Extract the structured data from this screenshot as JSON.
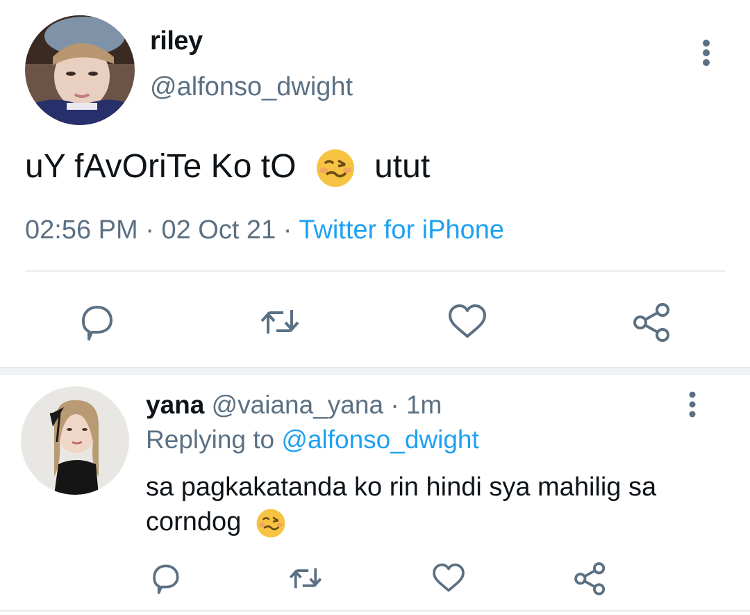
{
  "main_tweet": {
    "name": "riley",
    "handle": "@alfonso_dwight",
    "text_before_emoji": "uY fAvOriTe Ko tO",
    "emoji": "woozy-face",
    "text_after_emoji": "utut",
    "time": "02:56 PM",
    "date": "02 Oct 21",
    "separator": "·",
    "source": "Twitter for iPhone",
    "actions": [
      "reply-icon",
      "retweet-icon",
      "like-icon",
      "share-icon"
    ]
  },
  "reply": {
    "name": "yana",
    "handle": "@vaiana_yana",
    "separator": "·",
    "age": "1m",
    "replying_to_label": "Replying to",
    "replying_to_handle": "@alfonso_dwight",
    "text": "sa pagkakatanda ko rin hindi sya mahilig sa corndog",
    "emoji": "woozy-face",
    "actions": [
      "reply-icon",
      "retweet-icon",
      "like-icon",
      "share-icon"
    ]
  },
  "colors": {
    "text": "#0f1419",
    "secondary": "#5b7083",
    "link": "#1da1f2",
    "divider": "#e6ecf0"
  }
}
